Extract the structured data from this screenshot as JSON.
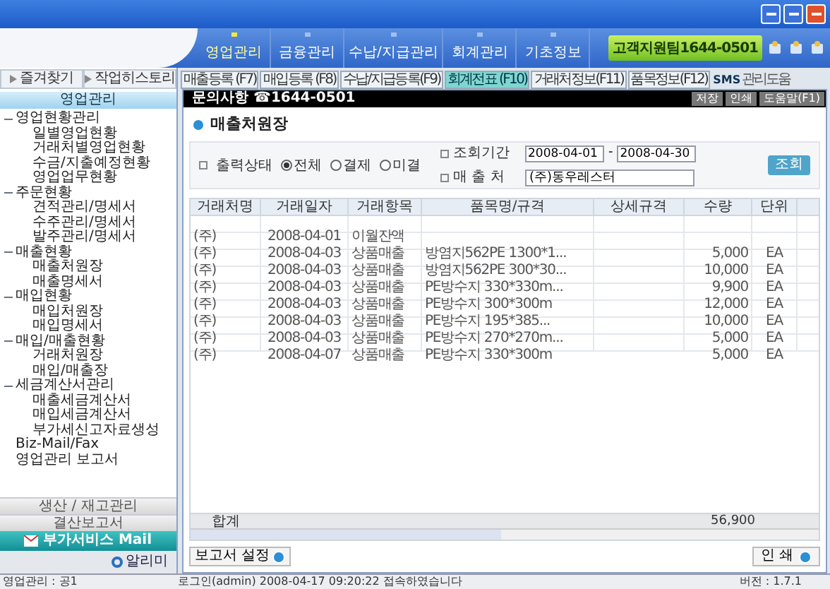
{
  "top_menu": [
    {
      "label": "영업관리",
      "selected": true
    },
    {
      "label": "금융관리",
      "selected": false
    },
    {
      "label": "수납/지급관리",
      "selected": false
    },
    {
      "label": "회계관리",
      "selected": false
    },
    {
      "label": "기초정보",
      "selected": false
    }
  ],
  "hotline": "고객지원팀1644-0501",
  "function_tabs": [
    {
      "label": "매출등록 (F7)",
      "selected": false
    },
    {
      "label": "매입등록 (F8)",
      "selected": false
    },
    {
      "label": "수납/지급등록(F9)",
      "selected": false
    },
    {
      "label": "회계전표 (F10)",
      "selected": true
    },
    {
      "label": "거래처정보(F11)",
      "selected": false
    },
    {
      "label": "품목정보(F12)",
      "selected": false
    }
  ],
  "sms": "SMS",
  "help_link": "관리도움",
  "sidebar": {
    "tabs": [
      "즐겨찾기",
      "작업히스토리"
    ],
    "header": "영업관리",
    "tree": [
      {
        "label": "영업현황관리",
        "children": [
          {
            "label": "일별영업현황"
          },
          {
            "label": "거래처별영업현황"
          },
          {
            "label": "수금/지출예정현황"
          },
          {
            "label": "영업업무현황"
          }
        ]
      },
      {
        "label": "주문현황",
        "children": [
          {
            "label": "견적관리/명세서"
          },
          {
            "label": "수주관리/명세서"
          },
          {
            "label": "발주관리/명세서"
          }
        ]
      },
      {
        "label": "매출현황",
        "children": [
          {
            "label": "매출처원장"
          },
          {
            "label": "매출명세서"
          }
        ]
      },
      {
        "label": "매입현황",
        "children": [
          {
            "label": "매입처원장"
          },
          {
            "label": "매입명세서"
          }
        ]
      },
      {
        "label": "매입/매출현황",
        "children": [
          {
            "label": "거래처원장"
          },
          {
            "label": "매입/매출장"
          }
        ]
      },
      {
        "label": "세금계산서관리",
        "children": [
          {
            "label": "매출세금계산서"
          },
          {
            "label": "매입세금계산서"
          },
          {
            "label": "부가세신고자료생성"
          }
        ]
      },
      {
        "label": "Biz-Mail/Fax"
      },
      {
        "label": "영업관리 보고서"
      }
    ],
    "sections": [
      "생산 / 재고관리",
      "결산보고서"
    ],
    "mail_button": "부가서비스 Mail",
    "alarm_button": "알리미"
  },
  "notice_bar": {
    "text": "문의사항 ☎1644-0501",
    "buttons": [
      "저장",
      "인쇄",
      "도움말(F1)"
    ]
  },
  "page_title": "매출처원장",
  "filter": {
    "status_label": "출력상태",
    "radios": [
      {
        "label": "전체",
        "selected": true
      },
      {
        "label": "결제",
        "selected": false
      },
      {
        "label": "미결",
        "selected": false
      }
    ],
    "period_label": "조회기간",
    "date_from": "2008-04-01",
    "date_separator": "-",
    "date_to": "2008-04-30",
    "customer_label": "매 출 처",
    "customer": "(주)동우레스터",
    "search_button": "조회"
  },
  "table": {
    "columns": [
      "거래처명",
      "거래일자",
      "거래항목",
      "품목명/규격",
      "상세규격",
      "수량",
      "단위"
    ],
    "rows": [
      [
        "(주)",
        "2008-04-01",
        "이월잔액",
        "",
        "",
        "",
        ""
      ],
      [
        "(주)",
        "2008-04-03",
        "상품매출",
        "방염지562PE 1300*1...",
        "",
        "5,000",
        "EA"
      ],
      [
        "(주)",
        "2008-04-03",
        "상품매출",
        "방염지562PE 300*30...",
        "",
        "10,000",
        "EA"
      ],
      [
        "(주)",
        "2008-04-03",
        "상품매출",
        "PE방수지 330*330m...",
        "",
        "9,900",
        "EA"
      ],
      [
        "(주)",
        "2008-04-03",
        "상품매출",
        "PE방수지 300*300m",
        "",
        "12,000",
        "EA"
      ],
      [
        "(주)",
        "2008-04-03",
        "상품매출",
        "PE방수지 195*385...",
        "",
        "10,000",
        "EA"
      ],
      [
        "(주)",
        "2008-04-03",
        "상품매출",
        "PE방수지 270*270m...",
        "",
        "5,000",
        "EA"
      ],
      [
        "(주)",
        "2008-04-07",
        "상품매출",
        "PE방수지 330*300m",
        "",
        "5,000",
        "EA"
      ]
    ],
    "total_label": "합계",
    "total_quantity": "56,900"
  },
  "report_settings_button": "보고서 설정",
  "print_button": "인 쇄",
  "status_bar": {
    "user": "영업관리 : 공1",
    "log": "로그인(admin) 2008-04-17 09:20:22 접속하였습니다",
    "version": "버전 : 1.7.1"
  }
}
